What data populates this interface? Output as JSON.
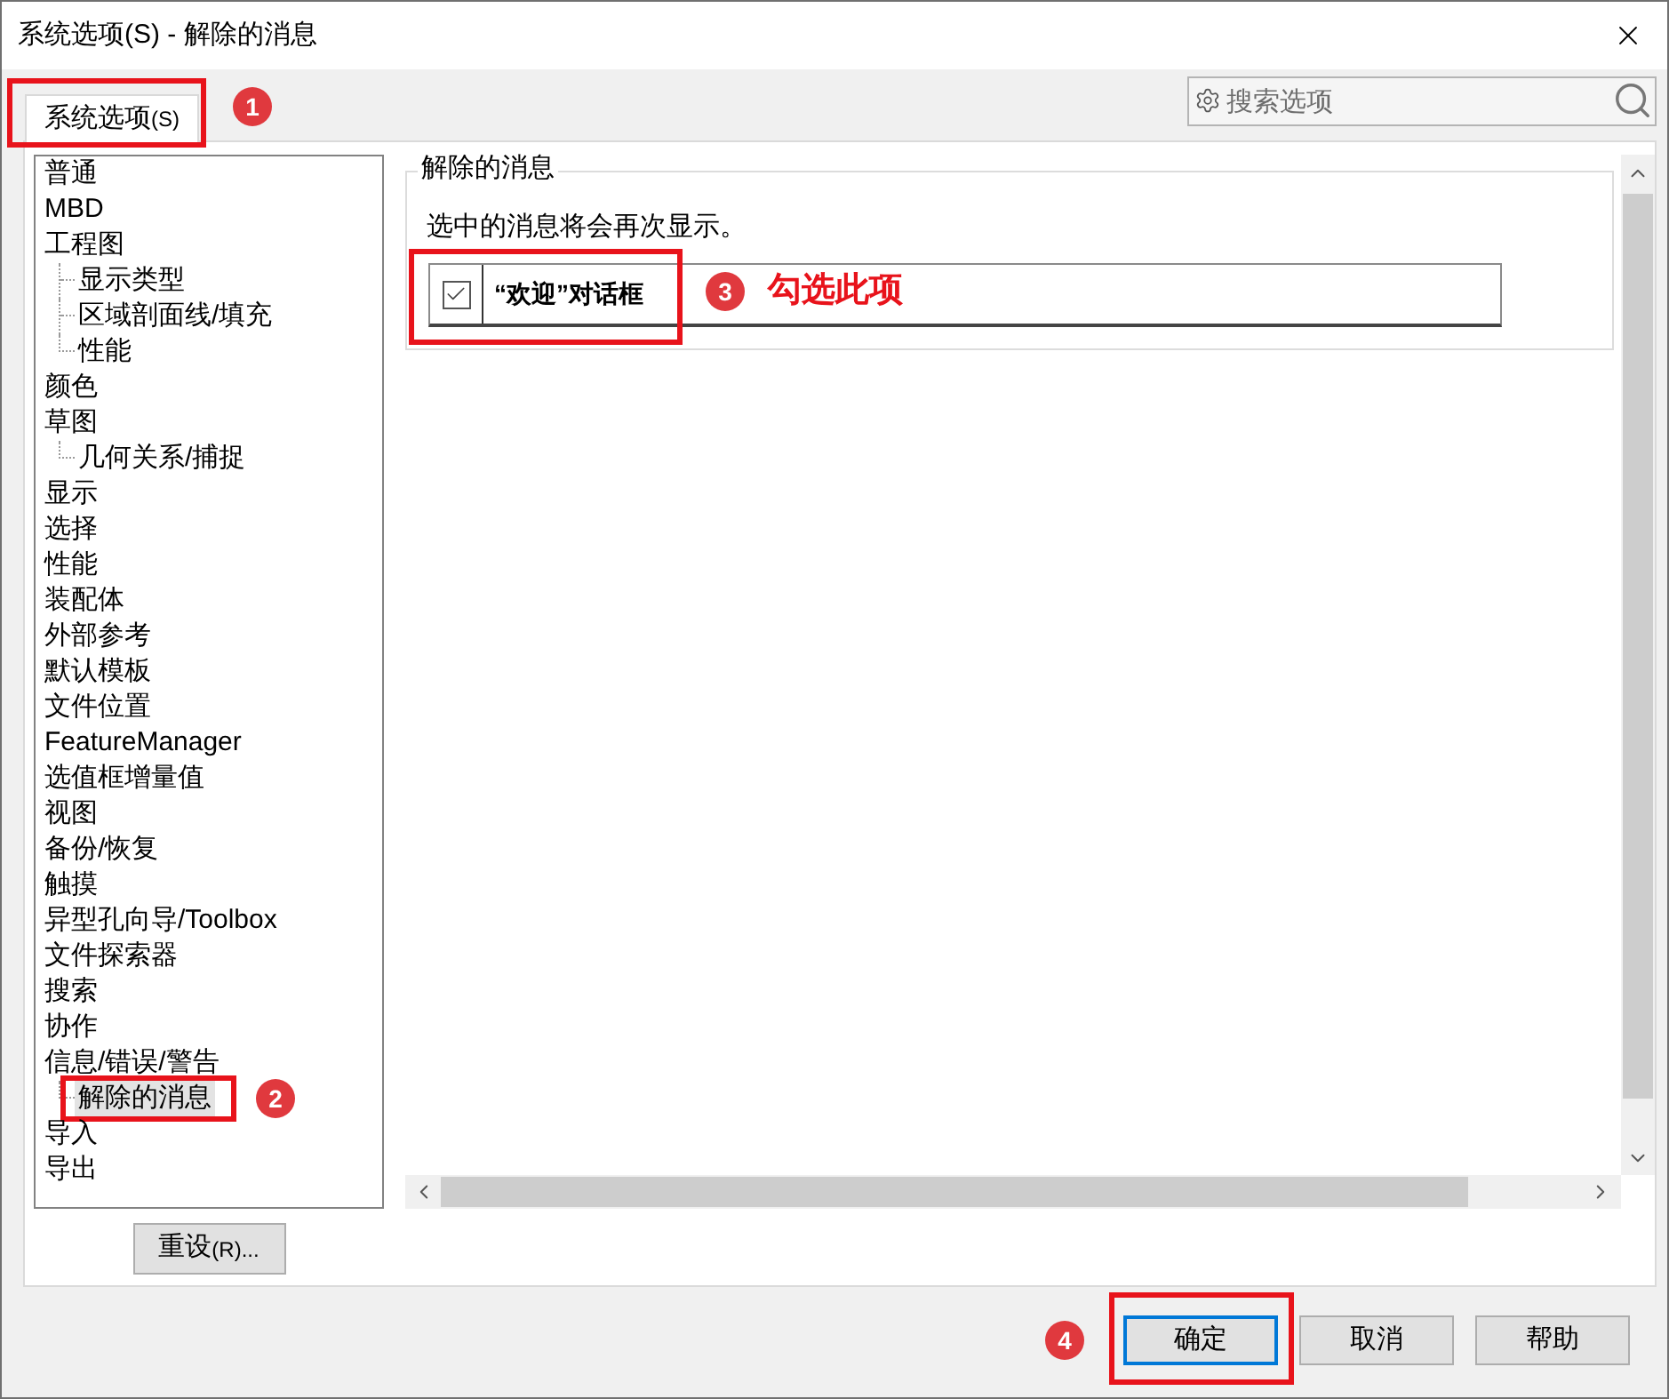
{
  "window": {
    "title": "系统选项(S) - 解除的消息"
  },
  "tabs": [
    {
      "label": "系统选项",
      "accelerator": "(S)",
      "selected": true,
      "callout": {
        "number": "1"
      }
    }
  ],
  "search": {
    "placeholder": "搜索选项"
  },
  "tree": {
    "items": [
      {
        "label": "普通",
        "selected": false
      },
      {
        "label": "MBD",
        "selected": false
      },
      {
        "label": "工程图",
        "selected": false,
        "children": [
          {
            "label": "显示类型",
            "selected": false
          },
          {
            "label": "区域剖面线/填充",
            "selected": false
          },
          {
            "label": "性能",
            "selected": false
          }
        ]
      },
      {
        "label": "颜色",
        "selected": false
      },
      {
        "label": "草图",
        "selected": false,
        "children": [
          {
            "label": "几何关系/捕捉",
            "selected": false
          }
        ]
      },
      {
        "label": "显示",
        "selected": false
      },
      {
        "label": "选择",
        "selected": false
      },
      {
        "label": "性能",
        "selected": false
      },
      {
        "label": "装配体",
        "selected": false
      },
      {
        "label": "外部参考",
        "selected": false
      },
      {
        "label": "默认模板",
        "selected": false
      },
      {
        "label": "文件位置",
        "selected": false
      },
      {
        "label": "FeatureManager",
        "selected": false
      },
      {
        "label": "选值框增量值",
        "selected": false
      },
      {
        "label": "视图",
        "selected": false
      },
      {
        "label": "备份/恢复",
        "selected": false
      },
      {
        "label": "触摸",
        "selected": false
      },
      {
        "label": "异型孔向导/Toolbox",
        "selected": false
      },
      {
        "label": "文件探索器",
        "selected": false
      },
      {
        "label": "搜索",
        "selected": false
      },
      {
        "label": "协作",
        "selected": false
      },
      {
        "label": "信息/错误/警告",
        "selected": false,
        "children": [
          {
            "label": "解除的消息",
            "selected": true,
            "callout": {
              "number": "2"
            }
          }
        ]
      },
      {
        "label": "导入",
        "selected": false
      },
      {
        "label": "导出",
        "selected": false
      }
    ]
  },
  "reset_button": {
    "label": "重设",
    "accelerator": "(R)..."
  },
  "panel": {
    "title": "解除的消息",
    "description": "选中的消息将会再次显示。",
    "messages": [
      {
        "label": "“欢迎”对话框",
        "checked": true,
        "callout": {
          "number": "3",
          "note": "勾选此项"
        }
      }
    ]
  },
  "buttons": [
    {
      "label": "确定",
      "default": true,
      "callout": {
        "number": "4"
      }
    },
    {
      "label": "取消",
      "default": false
    },
    {
      "label": "帮助",
      "default": false
    }
  ]
}
